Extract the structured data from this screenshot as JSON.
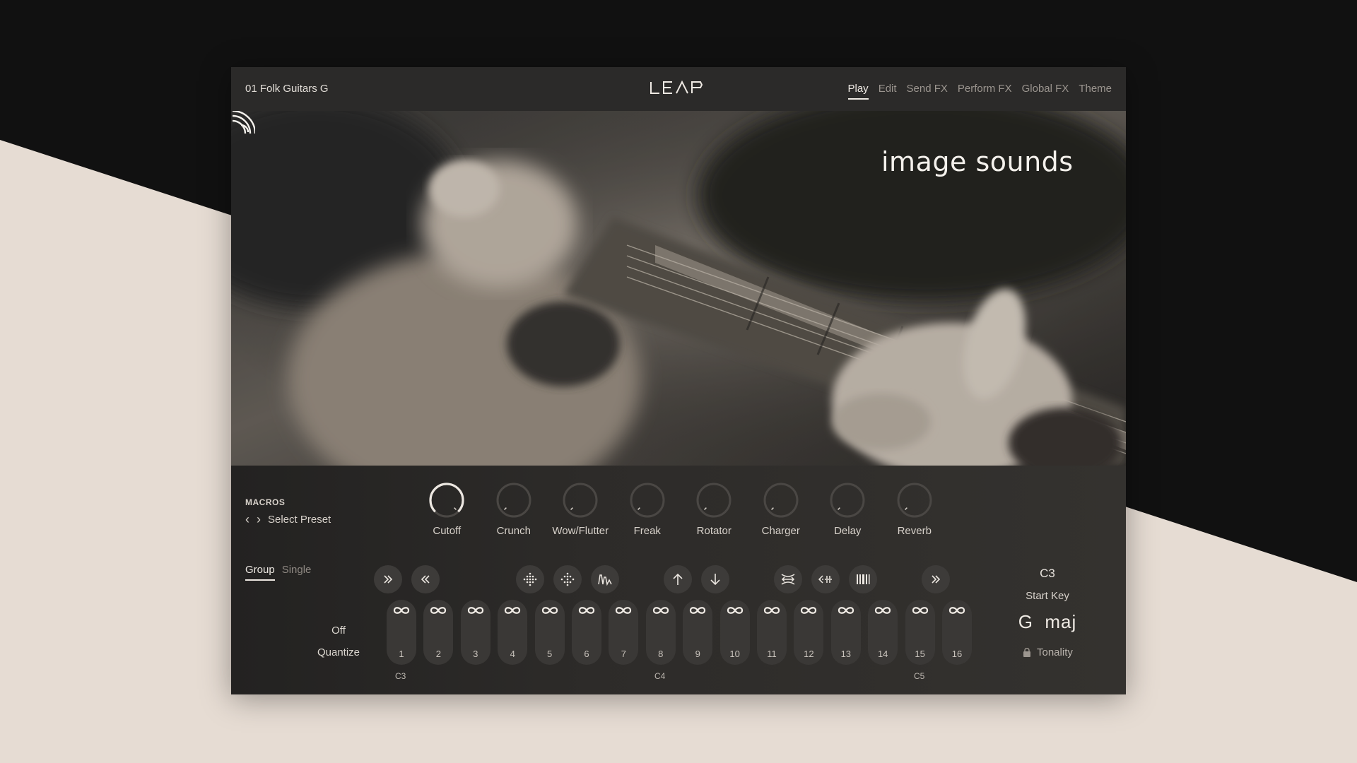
{
  "preset_name": "01 Folk Guitars G",
  "logo_text": "LEAP",
  "nav": {
    "tabs": [
      {
        "label": "Play",
        "active": true
      },
      {
        "label": "Edit",
        "active": false
      },
      {
        "label": "Send FX",
        "active": false
      },
      {
        "label": "Perform FX",
        "active": false
      },
      {
        "label": "Global FX",
        "active": false
      },
      {
        "label": "Theme",
        "active": false
      }
    ]
  },
  "brand": "image sounds",
  "macros": {
    "title": "MACROS",
    "select_preset": "Select Preset",
    "knobs": [
      {
        "label": "Cutoff",
        "value": 1.0
      },
      {
        "label": "Crunch",
        "value": 0.0
      },
      {
        "label": "Wow/Flutter",
        "value": 0.0
      },
      {
        "label": "Freak",
        "value": 0.0
      },
      {
        "label": "Rotator",
        "value": 0.0
      },
      {
        "label": "Charger",
        "value": 0.0
      },
      {
        "label": "Delay",
        "value": 0.0
      },
      {
        "label": "Reverb",
        "value": 0.0
      }
    ]
  },
  "mode": {
    "group": "Group",
    "single": "Single",
    "active": "Group"
  },
  "fx_buttons": [
    "fast-forward-icon",
    "rewind-icon",
    "diamond-dots-icon",
    "diamond-dots-alt-icon",
    "waveform-icon",
    "arrow-up-icon",
    "arrow-down-icon",
    "stretch-icon",
    "stutter-icon",
    "bars-icon",
    "forward-double-icon"
  ],
  "quantize": {
    "value": "Off",
    "label": "Quantize"
  },
  "pads": [
    "1",
    "2",
    "3",
    "4",
    "5",
    "6",
    "7",
    "8",
    "9",
    "10",
    "11",
    "12",
    "13",
    "14",
    "15",
    "16"
  ],
  "octaves": [
    "C3",
    "C4",
    "C5"
  ],
  "start_key": {
    "value": "C3",
    "label": "Start Key"
  },
  "tonality": {
    "value": "G  maj",
    "label": "Tonality",
    "icon": "lock-icon"
  },
  "colors": {
    "page_bg_light": "#e6dcd3",
    "page_bg_dark": "#111111",
    "panel_bg": "#2b2a29",
    "pad_bg": "#3a3836",
    "text_light": "#e2ddd7"
  }
}
